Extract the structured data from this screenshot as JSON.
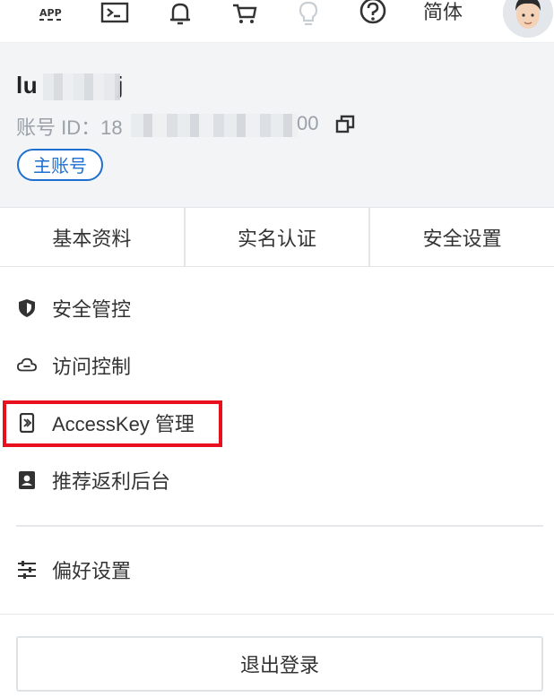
{
  "topbar": {
    "icons": [
      "app-icon",
      "terminal-icon",
      "bell-icon",
      "cart-icon",
      "lightbulb-icon",
      "help-icon"
    ],
    "language_label": "简体",
    "avatar": "user-avatar"
  },
  "account": {
    "name_prefix": "lu",
    "name_suffix": "j",
    "id_prefix": "账号 ID：18",
    "id_suffix": "00",
    "badge": "主账号"
  },
  "tabs": [
    "基本资料",
    "实名认证",
    "安全设置"
  ],
  "menu": {
    "items": [
      {
        "label": "安全管控",
        "icon": "shield-icon"
      },
      {
        "label": "访问控制",
        "icon": "cloud-icon"
      },
      {
        "label": "AccessKey 管理",
        "icon": "key-icon"
      },
      {
        "label": "推荐返利后台",
        "icon": "id-card-icon"
      }
    ],
    "preferences": {
      "label": "偏好设置",
      "icon": "sliders-icon"
    }
  },
  "logout_label": "退出登录",
  "colors": {
    "accent": "#1f6fd0",
    "highlight": "#e8101c",
    "card_bg": "#f2f4f6"
  }
}
